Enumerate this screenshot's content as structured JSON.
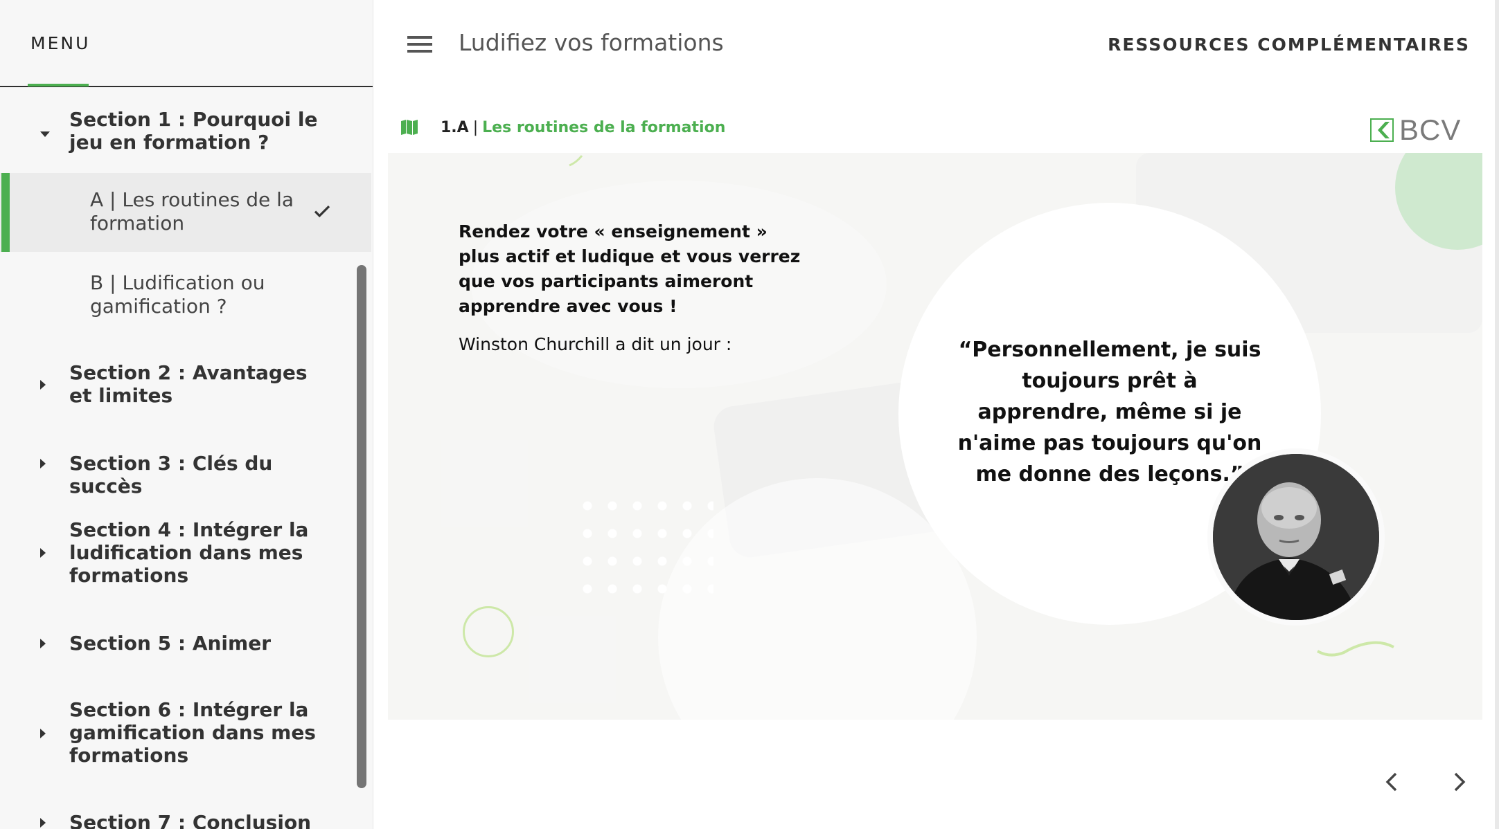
{
  "sidebar": {
    "menu_label": "MENU",
    "sections": [
      {
        "label": "Section 1 : Pourquoi le jeu en formation ?",
        "expanded": true
      },
      {
        "label": "Section 2 : Avantages et limites",
        "expanded": false
      },
      {
        "label": "Section 3 : Clés du succès",
        "expanded": false
      },
      {
        "label": "Section 4 : Intégrer la ludification dans mes formations",
        "expanded": false
      },
      {
        "label": "Section 5 : Animer",
        "expanded": false
      },
      {
        "label": "Section 6 : Intégrer la gamification dans mes formations",
        "expanded": false
      },
      {
        "label": "Section 7 : Conclusion",
        "expanded": false
      }
    ],
    "subitems": [
      {
        "label": "A | Les routines de la formation",
        "active": true,
        "completed": true
      },
      {
        "label": "B | Ludification ou gamification ?",
        "active": false,
        "completed": false
      }
    ]
  },
  "header": {
    "course_title": "Ludifiez vos formations",
    "resources_label": "RESSOURCES COMPLÉMENTAIRES"
  },
  "breadcrumb": {
    "number": "1.A",
    "separator": "|",
    "title": "Les routines de la formation"
  },
  "logo": {
    "text": "BCV"
  },
  "slide": {
    "intro": "Rendez votre « enseignement » plus actif et ludique et vous verrez que vos participants aimeront apprendre avec vous !",
    "attribution": "Winston Churchill a dit un jour :",
    "quote": "“Personnellement, je suis toujours prêt à apprendre, même si je n'aime pas toujours qu'on me donne des leçons.”"
  },
  "icons": {
    "menu": "hamburger-icon",
    "map": "map-icon",
    "check": "check-icon",
    "prev": "chevron-left-icon",
    "next": "chevron-right-icon"
  },
  "colors": {
    "accent": "#4caf50",
    "text": "#333333",
    "sidebar_bg": "#f7f7f7"
  }
}
